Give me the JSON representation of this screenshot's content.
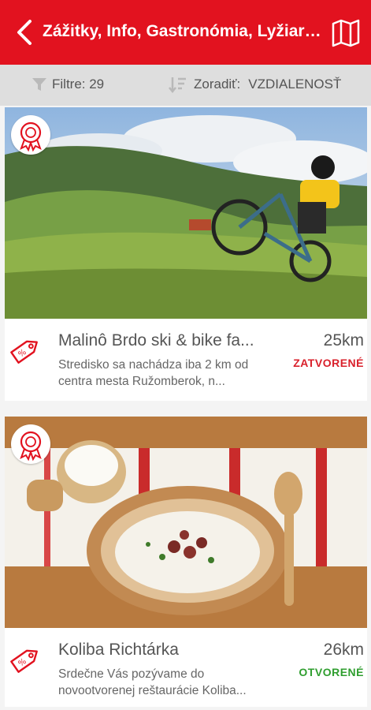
{
  "header": {
    "title": "Zážitky, Info, Gastronómia, Lyžiarske strediská",
    "back_icon": "back-arrow-icon",
    "map_icon": "map-icon",
    "color": "#e2121f"
  },
  "toolbar": {
    "filter_label": "Filtre: 29",
    "sort_label": "Zoradiť:",
    "sort_value": "VZDIALENOSŤ"
  },
  "items": [
    {
      "name": "Malinô Brdo ski & bike fa...",
      "description": "Stredisko sa nachádza iba 2 km od centra mesta Ružomberok, n...",
      "distance": "25km",
      "status": "ZATVORENÉ",
      "status_color": "#d9202b",
      "badge_icon": "award-badge-icon",
      "tag_icon": "discount-tag-icon"
    },
    {
      "name": "Koliba Richtárka",
      "description": "Srdečne Vás pozývame do novootvorenej reštaurácie Koliba...",
      "distance": "26km",
      "status": "OTVORENÉ",
      "status_color": "#2f9e2f",
      "badge_icon": "award-badge-icon",
      "tag_icon": "discount-tag-icon"
    }
  ]
}
